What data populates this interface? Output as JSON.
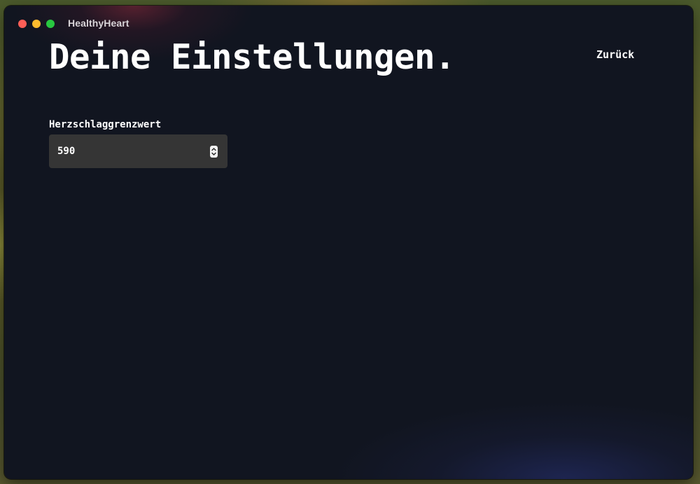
{
  "window": {
    "app_title": "HealthyHeart"
  },
  "header": {
    "title": "Deine Einstellungen.",
    "back_label": "Zurück"
  },
  "settings": {
    "heart_rate_threshold": {
      "label": "Herzschlaggrenzwert",
      "value": "590"
    }
  },
  "icons": {
    "window_close": "red-circle",
    "window_minimize": "yellow-circle",
    "window_maximize": "green-circle",
    "stepper": "up-down-chevrons-icon"
  },
  "colors": {
    "window_background": "#111520",
    "input_background": "#353535",
    "text": "#ffffff",
    "traffic_close": "#ff5f57",
    "traffic_minimize": "#febc2e",
    "traffic_maximize": "#28c840"
  }
}
